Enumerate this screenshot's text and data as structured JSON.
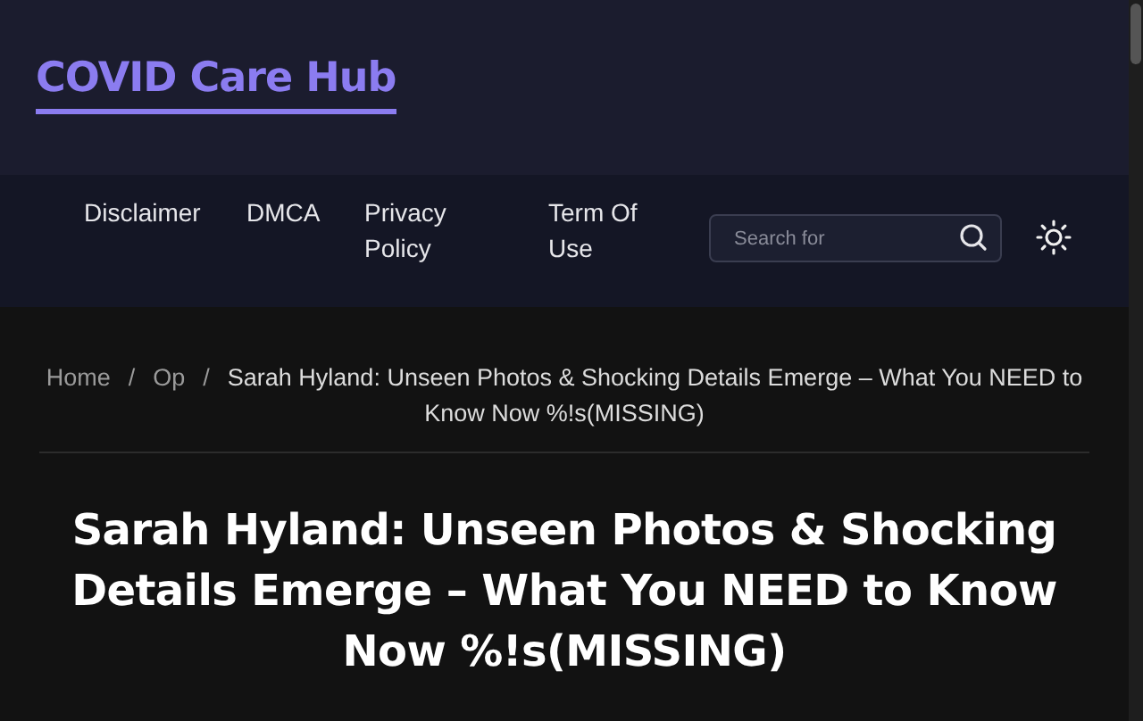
{
  "site": {
    "title": "COVID Care Hub"
  },
  "nav": {
    "items": [
      {
        "label": "Disclaimer"
      },
      {
        "label": "DMCA"
      },
      {
        "label": "Privacy Policy"
      },
      {
        "label": "Term Of Use"
      }
    ],
    "search": {
      "placeholder": "Search for"
    }
  },
  "breadcrumb": [
    {
      "label": "Home",
      "separator": "/"
    },
    {
      "label": "Op",
      "separator": "/"
    }
  ],
  "breadcrumb_current": "Sarah Hyland: Unseen Photos & Shocking Details Emerge – What You NEED to Know Now %!s(MISSING)",
  "article": {
    "title": "Sarah Hyland: Unseen Photos & Shocking Details Emerge – What You NEED to Know Now %!s(MISSING)"
  }
}
